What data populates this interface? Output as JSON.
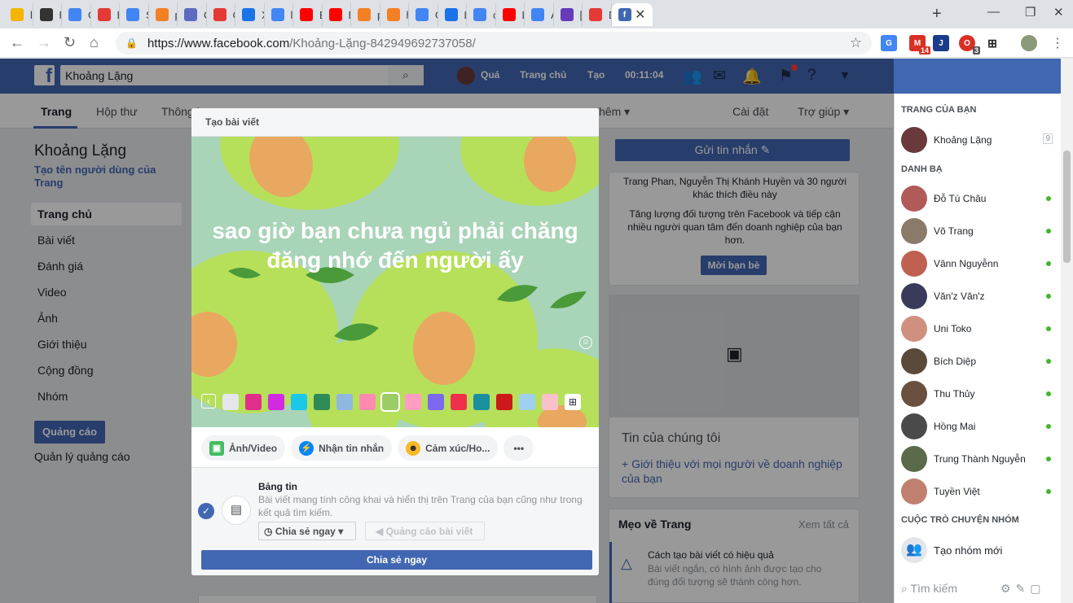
{
  "browser": {
    "tabs": [
      {
        "title": "lo",
        "color": "#f4b400"
      },
      {
        "title": "Pe",
        "color": "#333333"
      },
      {
        "title": "G",
        "color": "#4285f4"
      },
      {
        "title": "El",
        "color": "#e53935"
      },
      {
        "title": "SO",
        "color": "#4285f4"
      },
      {
        "title": "pl",
        "color": "#f48024"
      },
      {
        "title": "C",
        "color": "#5c6bc0"
      },
      {
        "title": "Cr",
        "color": "#e53935"
      },
      {
        "title": "Xi",
        "color": "#1a73e8"
      },
      {
        "title": "lie",
        "color": "#4285f4"
      },
      {
        "title": "Bi",
        "color": "#ff0000"
      },
      {
        "title": "D",
        "color": "#ff0000"
      },
      {
        "title": "pl",
        "color": "#f48024"
      },
      {
        "title": "h",
        "color": "#f48024"
      },
      {
        "title": "G",
        "color": "#4285f4"
      },
      {
        "title": "Li",
        "color": "#1a73e8"
      },
      {
        "title": "ch",
        "color": "#4285f4"
      },
      {
        "title": "Li",
        "color": "#ff0000"
      },
      {
        "title": "A",
        "color": "#4285f4"
      },
      {
        "title": "[F",
        "color": "#673ab7"
      },
      {
        "title": "D",
        "color": "#e53935"
      },
      {
        "title": "",
        "color": "#4267b2"
      }
    ],
    "new_tab": "+",
    "min": "—",
    "restore": "❐",
    "close": "✕",
    "tab_close": "✕",
    "url_host": "https://www.facebook.com",
    "url_path": "/Khoảng-Lặng-842949692737058/",
    "ext_badge_gmail": "14",
    "ext_badge_other": "3"
  },
  "fb": {
    "search_value": "Khoảng Lặng",
    "nav_user": "Quá",
    "nav_home": "Trang chủ",
    "nav_create": "Tạo",
    "timer": "00:11:04"
  },
  "pagetabs": {
    "page": "Trang",
    "inbox": "Hộp thư",
    "notifications": "Thông b",
    "more": "hêm ▾",
    "settings": "Cài đặt",
    "help": "Trợ giúp ▾"
  },
  "left": {
    "page_name": "Khoảng Lặng",
    "username_hint": "Tạo tên người dùng của Trang",
    "nav": [
      "Trang chủ",
      "Bài viết",
      "Đánh giá",
      "Video",
      "Ảnh",
      "Giới thiệu",
      "Cộng đồng",
      "Nhóm"
    ],
    "ads_button": "Quảng cáo",
    "ads_manage": "Quản lý quảng cáo"
  },
  "right": {
    "send_message": "Gửi tin nhắn ✎",
    "likes_text": "Trang Phan, Nguyễn Thị Khánh Huyền và 30 người khác thích điều này",
    "boost_text": "Tăng lượng đối tượng trên Facebook và tiếp cận nhiều người quan tâm đến doanh nghiệp của bạn hơn.",
    "invite": "Mời bạn bè",
    "story_heading": "Tin của chúng tôi",
    "story_link": "+ Giới thiệu với mọi người về doanh nghiệp của bạn",
    "tips_heading": "Mẹo về Trang",
    "tips_more": "Xem tất cả",
    "tip_title": "Cách tạo bài viết có hiệu quả",
    "tip_desc": "Bài viết ngắn, có hình ảnh được tạo cho đúng đối tượng sẽ thành công hơn."
  },
  "chat": {
    "your_pages_heading": "TRANG CỦA BẠN",
    "your_page": "Khoảng Lặng",
    "your_page_count": "9",
    "contacts_heading": "DANH BẠ",
    "contacts": [
      {
        "name": "Đỗ Tú Châu",
        "color": "#b05a5a"
      },
      {
        "name": "Võ Trang",
        "color": "#8a7a6a"
      },
      {
        "name": "Vânn Nguyễnn",
        "color": "#c06050"
      },
      {
        "name": "Văn'z Văn'z",
        "color": "#3a3a5a"
      },
      {
        "name": "Uni Toko",
        "color": "#d09080"
      },
      {
        "name": "Bích Diệp",
        "color": "#5a4a3a"
      },
      {
        "name": "Thu Thủy",
        "color": "#6a5040"
      },
      {
        "name": "Hồng Mai",
        "color": "#4a4a4a"
      },
      {
        "name": "Trung Thành Nguyễn",
        "color": "#5a6a4a"
      },
      {
        "name": "Tuyền Việt",
        "color": "#c08070"
      }
    ],
    "groups_heading": "CUỘC TRÒ CHUYỆN NHÓM",
    "new_group": "Tạo nhóm mới",
    "search_placeholder": "Tìm kiếm"
  },
  "modal": {
    "title": "Tạo bài viết",
    "post_text": "sao giờ bạn chưa ngủ phải chăng đăng nhớ đến người ấy",
    "swatches": [
      "#e4e6eb",
      "#e02f8a",
      "#d22ae0",
      "#1cc8e8",
      "#2e8b57",
      "#8fb8e0",
      "#ff8ab0",
      "#9ccc65",
      "#ff9ec0",
      "#7b68ee",
      "#f0304a",
      "#1a8fa0",
      "#cc1a1a",
      "#a0d0f0",
      "#f8c0c8"
    ],
    "btn_photo": "Ảnh/Video",
    "btn_message": "Nhận tin nhắn",
    "btn_feeling": "Cảm xúc/Ho...",
    "btn_more": "•••",
    "feed_title": "Bảng tin",
    "feed_desc": "Bài viết mang tính công khai và hiển thị trên Trang của bạn cũng như trong kết quả tìm kiếm.",
    "share_select": "Chia sẻ ngay",
    "boost": "Quảng cáo bài viết",
    "share_button": "Chia sẻ ngay"
  }
}
